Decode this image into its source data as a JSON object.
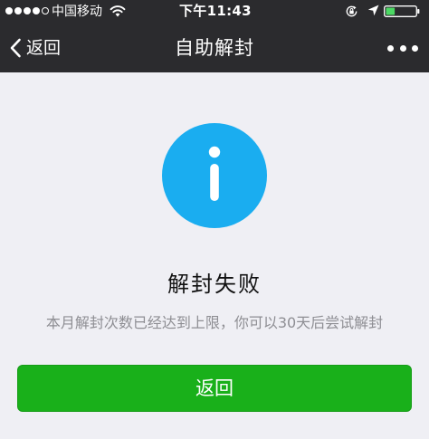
{
  "status_bar": {
    "carrier": "中国移动",
    "time": "下午11:43",
    "signal_bars_filled": 4,
    "signal_bars_total": 5,
    "battery_level": 0.3,
    "icons": [
      "signal-dots-icon",
      "wifi-icon",
      "rotation-lock-icon",
      "location-arrow-icon",
      "battery-icon"
    ]
  },
  "nav": {
    "back_label": "返回",
    "title": "自助解封",
    "more_icon": "more-dots-icon"
  },
  "result": {
    "icon": "info-icon",
    "title": "解封失败",
    "description": "本月解封次数已经达到上限，你可以30天后尝试解封"
  },
  "actions": {
    "back_button": "返回"
  },
  "colors": {
    "header_bg": "#2b2b2e",
    "page_bg": "#efeff4",
    "info_blue": "#1aadf0",
    "button_green": "#19b01a",
    "battery_green": "#4cd964"
  }
}
